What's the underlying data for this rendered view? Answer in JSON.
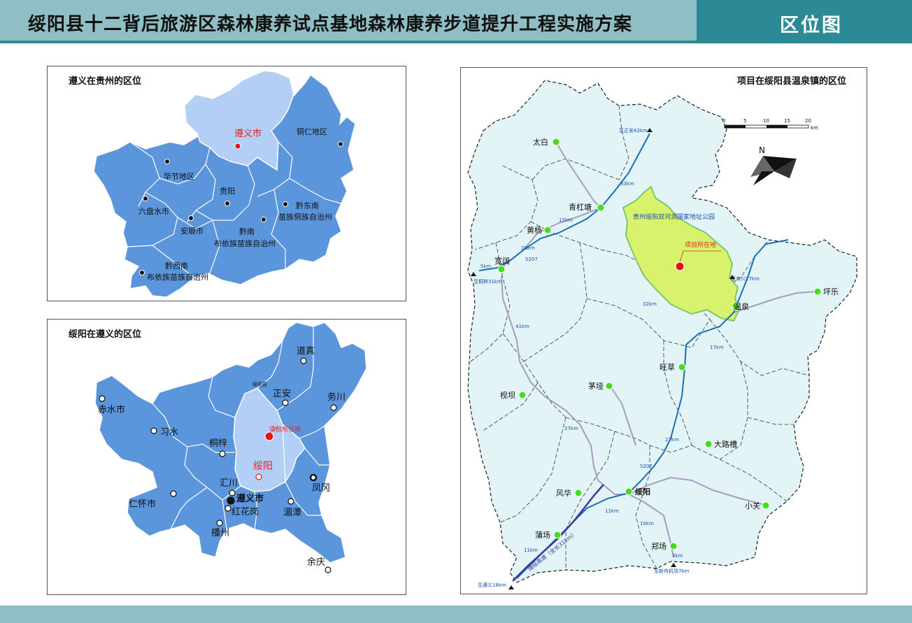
{
  "header": {
    "title": "绥阳县十二背后旅游区森林康养试点基地森林康养步道提升工程实施方案",
    "right_title": "区位图"
  },
  "panel_guizhou": {
    "title": "遵义在贵州的区位",
    "labels": {
      "zunyi": "遵义市",
      "tongren": "铜仁地区",
      "bijie": "毕节地区",
      "guiyang": "贵阳",
      "qiandongnan_1": "黔东南",
      "qiandongnan_2": "苗族侗族自治州",
      "liupanshui": "六盘水市",
      "anshun": "安顺市",
      "qiannan_1": "黔南",
      "qiannan_2": "布依族苗族自治州",
      "qianxinan_1": "黔西南",
      "qianxinan_2": "布依族苗族自治州"
    }
  },
  "panel_zunyi": {
    "title": "绥阳在遵义的区位",
    "labels": {
      "daozhen": "道真",
      "suiyangxian": "绥阳县",
      "zhengan": "正安",
      "wuchuan": "务川",
      "chishui": "赤水市",
      "xishui": "习水",
      "tongzi": "桐梓",
      "project": "项目所在地",
      "suiyang": "绥阳",
      "huichuan": "汇川",
      "fenggang": "凤冈",
      "zunyishi": "遵义市",
      "renhuai": "仁怀市",
      "honghuagang": "红花岗",
      "meitan": "湄潭",
      "bozhou": "播州",
      "yuqing": "余庆"
    }
  },
  "panel_town": {
    "title": "项目在绥阳县温泉镇的区位",
    "scale_ticks": [
      "0",
      "5",
      "10",
      "15",
      "20"
    ],
    "scale_unit": "km",
    "north_label": "N",
    "park_label": "贵州绥阳双河洞国家地址公园",
    "project_label": "项目所在地",
    "towns": {
      "taibai": "太白",
      "qinggangtang": "青杠塘",
      "huangyang": "黄杨",
      "kuankuo": "宽阔",
      "wenquan": "温泉",
      "pingle": "坪乐",
      "wangcao": "旺草",
      "maoya": "茅垭",
      "pumo": "枧坝",
      "dalucao": "大路槽",
      "fenghua": "风华",
      "suiyang": "绥阳",
      "xiaoguan": "小关",
      "puchang": "蒲场",
      "zhengchang": "郑场"
    },
    "road_labels": {
      "to_zhengan": "至正安42km",
      "to_tongzi": "至桐梓31km",
      "to_wuchuan": "至务川27km",
      "to_zunyi": "至遵义18km",
      "to_airport": "至新舟机场7km",
      "expressway": "遵绥高速（全长31km）",
      "d33": "33km",
      "d15": "15km",
      "d20": "20km",
      "d5": "5km",
      "d41": "41km",
      "d32": "32km",
      "d17": "17km",
      "d27a": "27km",
      "d27b": "27km",
      "d11a": "11km",
      "d10": "10km",
      "d11b": "11km",
      "d3": "3km",
      "s207a": "S207",
      "s207b": "S207"
    },
    "colors": {
      "land": "#e2f4f6",
      "park": "#d9f26e",
      "town_dot": "#44dd22",
      "river": "#1a6fb5",
      "road": "#a89cc0",
      "project": "#e81010"
    }
  },
  "colors": {
    "header": "#8fbfc4",
    "header_dark": "#2b8a95",
    "region": "#5b95db",
    "highlight_region": "#b3cff5",
    "highlight_text": "#e02020"
  }
}
